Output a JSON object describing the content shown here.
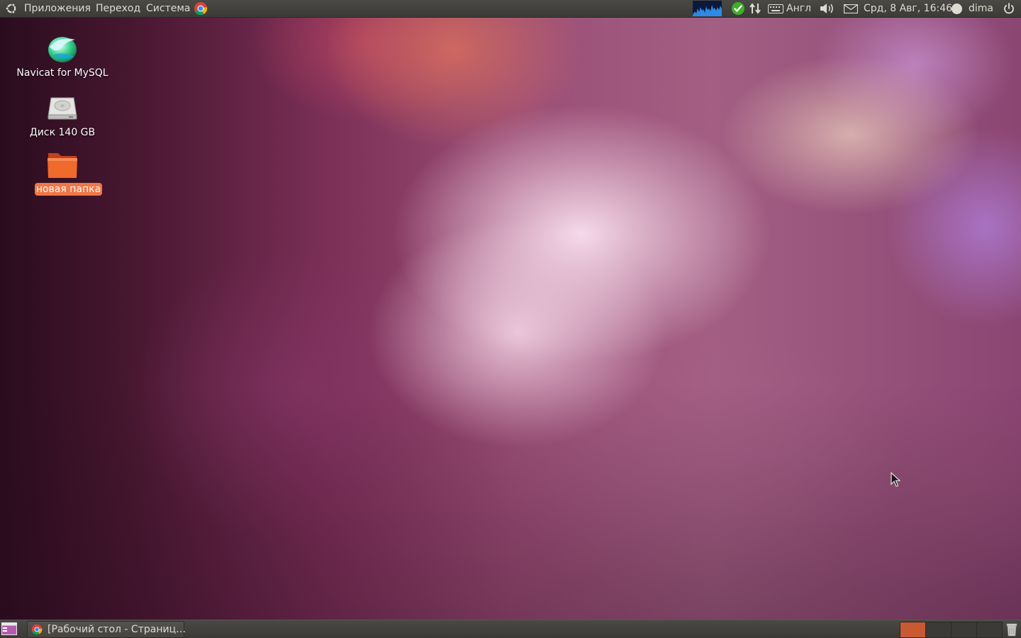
{
  "top_panel": {
    "menus": [
      "Приложения",
      "Переход",
      "Система"
    ],
    "keyboard_layout": "Англ",
    "clock": "Срд, 8 Авг, 16:46",
    "user": "dima",
    "icons": [
      "ubuntu-logo-icon",
      "chrome-icon",
      "system-monitor-graph",
      "update-check-icon",
      "network-arrows-icon",
      "keyboard-icon",
      "volume-icon",
      "mail-icon",
      "user-icon",
      "power-icon"
    ]
  },
  "desktop": {
    "icons": [
      {
        "label": "Navicat for MySQL",
        "icon": "navicat-icon",
        "selected": false
      },
      {
        "label": "Диск 140 GB",
        "icon": "hard-disk-icon",
        "selected": false
      },
      {
        "label": "новая папка",
        "icon": "folder-icon",
        "selected": true
      }
    ]
  },
  "bottom_panel": {
    "show_desktop_icon": "show-desktop-icon",
    "task": {
      "title": "[Рабочий стол - Страниц…",
      "icon": "chrome-icon"
    },
    "workspaces": {
      "count": 4,
      "active": 1
    },
    "trash_icon": "trash-icon"
  },
  "colors": {
    "panel": "#3c3b37",
    "selection": "#f07746",
    "workspace_active": "#c75a30"
  }
}
